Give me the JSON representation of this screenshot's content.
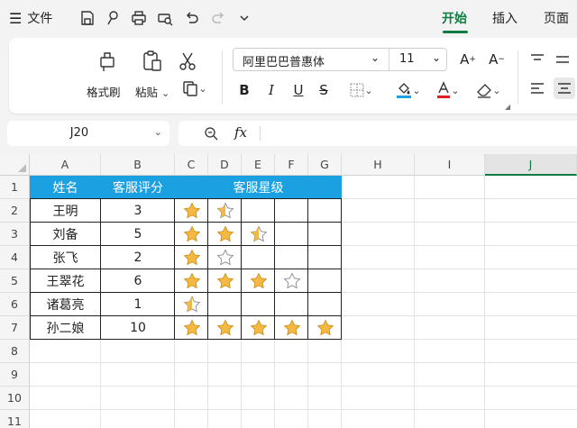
{
  "menu": {
    "file_label": "文件",
    "tabs": [
      {
        "label": "开始",
        "active": true
      },
      {
        "label": "插入",
        "active": false
      },
      {
        "label": "页面",
        "active": false
      }
    ]
  },
  "ribbon": {
    "format_painter": "格式刷",
    "paste": "粘贴",
    "font_name": "阿里巴巴普惠体",
    "font_size": "11",
    "buttons": {
      "bold": "B",
      "italic": "I",
      "underline": "U",
      "strike": "S",
      "increase_font": "A⁺",
      "decrease_font": "A⁻"
    }
  },
  "formula_bar": {
    "name_box": "J20",
    "fx_label": "fx",
    "formula": ""
  },
  "sheet": {
    "columns": [
      "A",
      "B",
      "C",
      "D",
      "E",
      "F",
      "G",
      "H",
      "I",
      "J"
    ],
    "rows": [
      "1",
      "2",
      "3",
      "4",
      "5",
      "6",
      "7",
      "8",
      "9",
      "10",
      "11"
    ],
    "selected_column": "J",
    "header": {
      "name": "姓名",
      "score": "客服评分",
      "stars": "客服星级"
    },
    "records": [
      {
        "name": "王明",
        "score": "3",
        "stars": 1.5
      },
      {
        "name": "刘备",
        "score": "5",
        "stars": 2.5
      },
      {
        "name": "张飞",
        "score": "2",
        "stars": 1
      },
      {
        "name": "王翠花",
        "score": "6",
        "stars": 3
      },
      {
        "name": "诸葛亮",
        "score": "1",
        "stars": 0.5
      },
      {
        "name": "孙二娘",
        "score": "10",
        "stars": 5
      }
    ]
  },
  "colors": {
    "accent": "#107c41",
    "header_fill": "#1ba1e2",
    "star_fill": "#f4b942"
  }
}
